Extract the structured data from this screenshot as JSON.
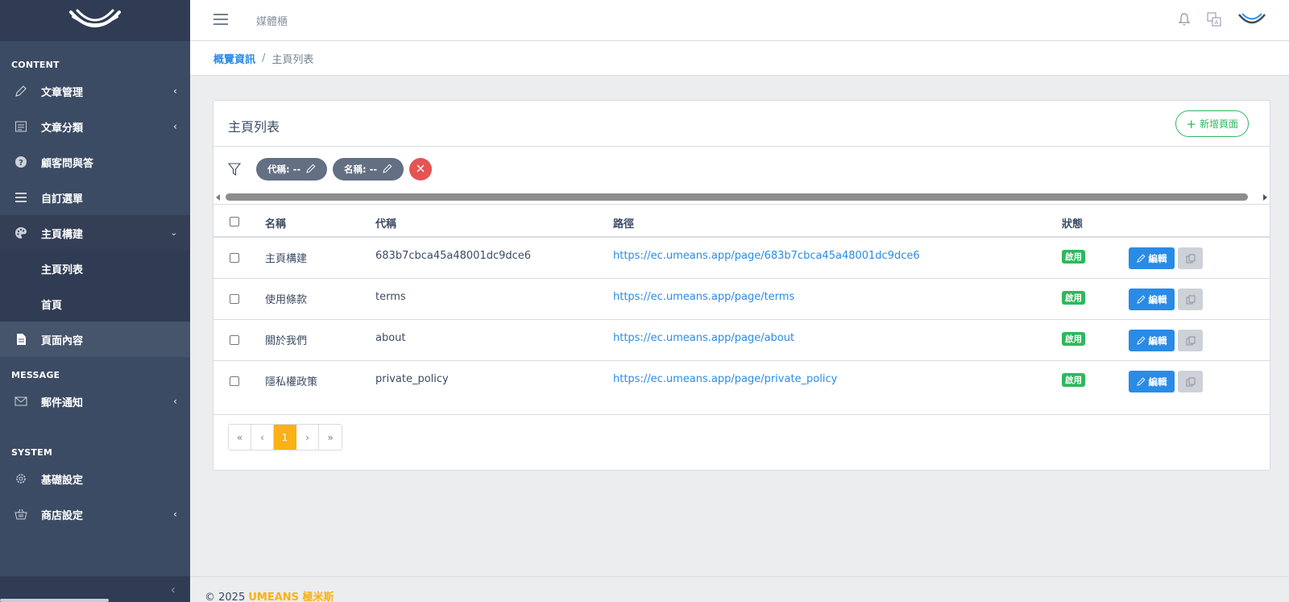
{
  "header": {
    "title": "媒體櫃",
    "icons": [
      "bell-icon",
      "translate-icon",
      "brand-logo"
    ]
  },
  "breadcrumb": {
    "home": "概覽資訊",
    "separator": "/",
    "current": "主頁列表"
  },
  "sidebar": {
    "sections": {
      "content": "CONTENT",
      "message": "MESSAGE",
      "system": "SYSTEM"
    },
    "items": {
      "articles": "文章管理",
      "categories": "文章分類",
      "faq": "顧客問與答",
      "custom_menu": "自訂選單",
      "homepage_builder": "主頁構建",
      "homepage_list": "主頁列表",
      "home": "首頁",
      "page_content": "頁面內容",
      "mail_notice": "郵件通知",
      "basic_settings": "基礎設定",
      "shop_settings": "商店設定"
    }
  },
  "card": {
    "title": "主頁列表",
    "add_button": "新增頁面"
  },
  "filters": {
    "chips": [
      {
        "label": "代稱: --"
      },
      {
        "label": "名稱: --"
      }
    ]
  },
  "table": {
    "headers": {
      "name": "名稱",
      "code": "代稱",
      "path": "路徑",
      "status": "狀態"
    },
    "rows": [
      {
        "name": "主頁構建",
        "code": "683b7cbca45a48001dc9dce6",
        "path": "https://ec.umeans.app/page/683b7cbca45a48001dc9dce6",
        "status": "啟用"
      },
      {
        "name": "使用條款",
        "code": "terms",
        "path": "https://ec.umeans.app/page/terms",
        "status": "啟用"
      },
      {
        "name": "關於我們",
        "code": "about",
        "path": "https://ec.umeans.app/page/about",
        "status": "啟用"
      },
      {
        "name": "隱私權政策",
        "code": "private_policy",
        "path": "https://ec.umeans.app/page/private_policy",
        "status": "啟用"
      }
    ],
    "edit_label": "編輯"
  },
  "pagination": {
    "first": "«",
    "prev": "‹",
    "current": "1",
    "next": "›",
    "last": "»"
  },
  "footer": {
    "copyright": "© 2025",
    "brand": "UMEANS 極米斯"
  },
  "colors": {
    "sidebar": "#3c4b64",
    "primary": "#2a8be6",
    "success": "#2eb85c",
    "danger": "#e55353",
    "warning": "#f9b115"
  }
}
